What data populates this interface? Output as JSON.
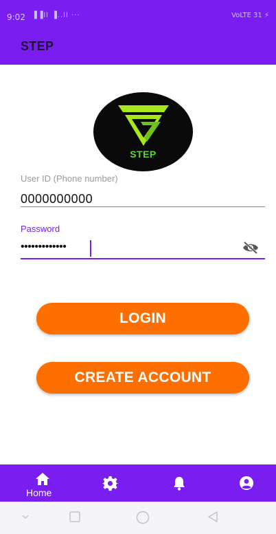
{
  "status_bar": {
    "time": "9:02",
    "signals": "▐▐ll ▐..ll ···",
    "right": "VoLTE 31 ⚡"
  },
  "app_bar": {
    "title": "STEP"
  },
  "logo": {
    "text": "STEP",
    "colors": {
      "background": "#0a0a0a",
      "mark": "#a8e61e",
      "text": "#5cd634"
    }
  },
  "form": {
    "user_id": {
      "label": "User ID (Phone number)",
      "value": "0000000000"
    },
    "password": {
      "label": "Password",
      "value": "•••••••••••••",
      "toggle_icon": "eye-off-icon"
    }
  },
  "buttons": {
    "login": "LOGIN",
    "create_account": "CREATE ACCOUNT"
  },
  "bottom_nav": {
    "items": [
      {
        "name": "home",
        "label": "Home",
        "icon": "home-icon"
      },
      {
        "name": "settings",
        "label": "",
        "icon": "gear-icon"
      },
      {
        "name": "alerts",
        "label": "",
        "icon": "bell-icon"
      },
      {
        "name": "profile",
        "label": "",
        "icon": "account-circle-icon"
      }
    ]
  },
  "colors": {
    "primary": "#7a1df0",
    "accent": "#ff6f00",
    "text": "#111111",
    "muted": "#9a9a9a"
  }
}
